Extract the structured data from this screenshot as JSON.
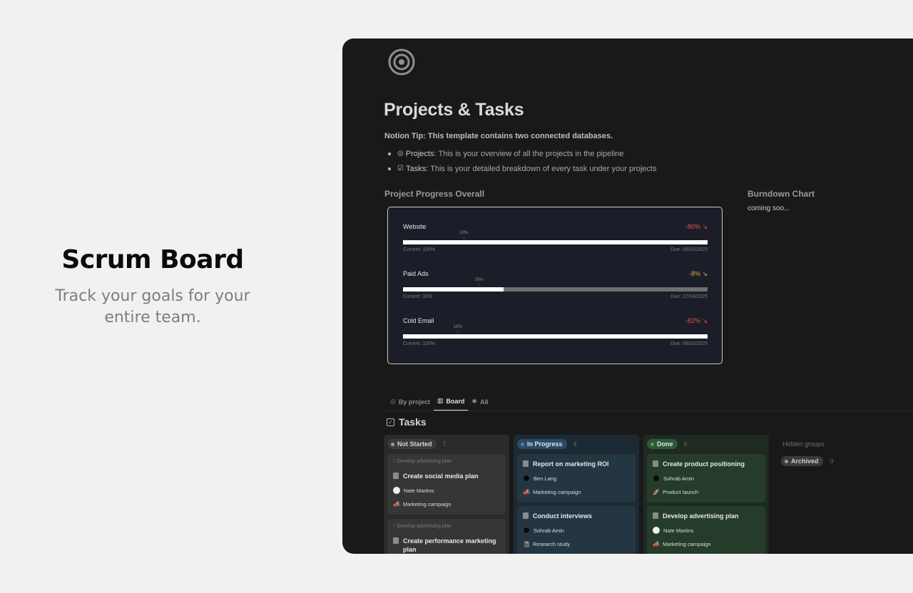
{
  "hero": {
    "title": "Scrum Board",
    "subtitle": "Track your goals for your entire team."
  },
  "page": {
    "icon": "target-icon",
    "title": "Projects & Tasks",
    "tip": "Notion Tip: This template contains two connected databases.",
    "bullets": [
      {
        "icon": "projects-icon",
        "label": "Projects:",
        "text": "This is your overview of all the projects in the pipeline"
      },
      {
        "icon": "tasks-icon",
        "label": "Tasks:",
        "text": "This is your detailed breakdown of every task under your projects"
      }
    ]
  },
  "progress": {
    "title": "Project Progress Overall",
    "rows": [
      {
        "name": "Website",
        "delta": "-80%",
        "delta_color": "#e5534b",
        "marker": "20%",
        "marker_value": 0.2,
        "fill": 1.0,
        "current": "Current: 100%",
        "due": "Due: 06/02/2025"
      },
      {
        "name": "Paid Ads",
        "delta": "-8%",
        "delta_color": "#e8a93a",
        "marker": "25%",
        "marker_value": 0.25,
        "fill": 0.33,
        "current": "Current: 33%",
        "due": "Due: 27/04/2025"
      },
      {
        "name": "Cold Email",
        "delta": "-82%",
        "delta_color": "#e5534b",
        "marker": "18%",
        "marker_value": 0.18,
        "fill": 1.0,
        "current": "Current: 100%",
        "due": "Due: 06/02/2025"
      }
    ]
  },
  "burndown": {
    "title": "Burndown Chart",
    "subtitle": "coming soo..."
  },
  "tabs": [
    {
      "label": "By project",
      "icon": "target-icon",
      "active": false
    },
    {
      "label": "Board",
      "icon": "board-icon",
      "active": true
    },
    {
      "label": "All",
      "icon": "asterisk-icon",
      "active": false
    }
  ],
  "tasks": {
    "title": "Tasks",
    "columns": [
      {
        "status": "Not Started",
        "count": "7",
        "cards": [
          {
            "parent": "↑ Develop advertising plan",
            "title": "Create social media plan",
            "person": "Nate Martins",
            "project": "Marketing campaign"
          },
          {
            "parent": "↑ Develop advertising plan",
            "title": "Create performance marketing plan"
          }
        ]
      },
      {
        "status": "In Progress",
        "count": "4",
        "cards": [
          {
            "title": "Report on marketing ROI",
            "person": "Ben Lang",
            "project": "Marketing campaign"
          },
          {
            "title": "Conduct interviews",
            "person": "Sohrab Amin",
            "project": "Research study"
          }
        ]
      },
      {
        "status": "Done",
        "count": "6",
        "cards": [
          {
            "title": "Create product positioning",
            "person": "Sohrab Amin",
            "project": "Product launch"
          },
          {
            "title": "Develop advertising plan",
            "person": "Nate Martins",
            "project": "Marketing campaign"
          }
        ]
      }
    ],
    "hidden_groups": "Hidden groups",
    "archived": {
      "label": "Archived",
      "count": "0"
    }
  },
  "colors": {
    "not_started_bg": "#2a2a2a",
    "in_progress_bg": "#1e2a33",
    "in_progress_card": "#243642",
    "done_bg": "#1f2a22",
    "done_card": "#263c2b"
  }
}
